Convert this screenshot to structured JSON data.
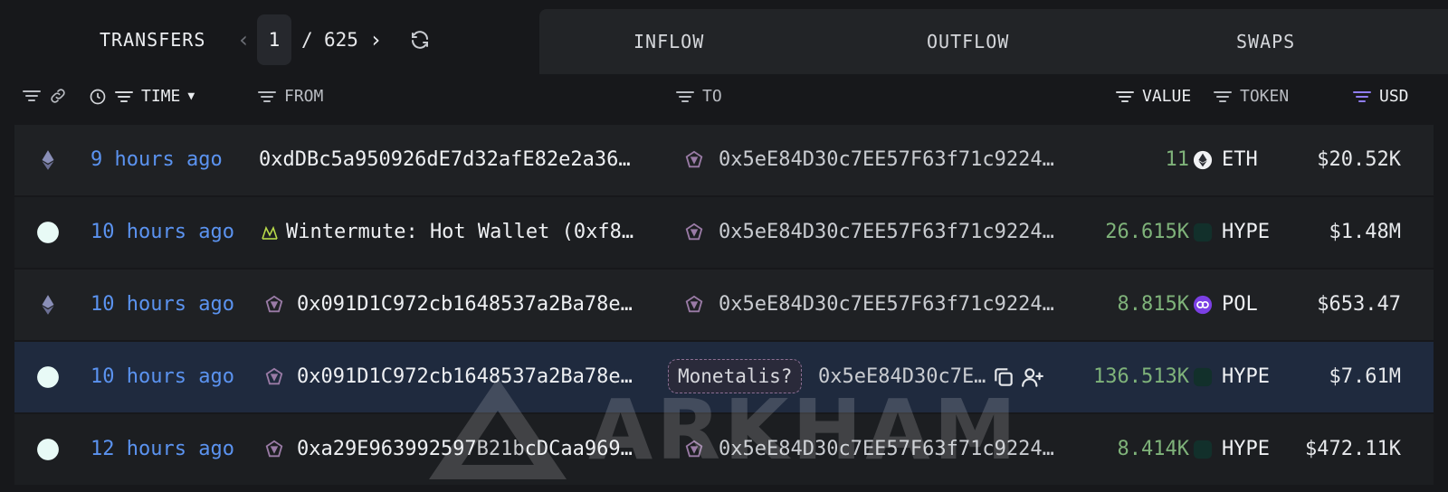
{
  "topbar": {
    "transfers_label": "TRANSFERS",
    "prev_icon": "chevron-left-icon",
    "page_current": "1",
    "page_sep": "/",
    "page_total": "625",
    "next_icon": "chevron-right-icon",
    "refresh_icon": "refresh-icon",
    "tabs": [
      {
        "label": "INFLOW"
      },
      {
        "label": "OUTFLOW"
      },
      {
        "label": "SWAPS"
      }
    ]
  },
  "columns": {
    "time": "TIME",
    "from": "FROM",
    "to": "TO",
    "value": "VALUE",
    "token": "TOKEN",
    "usd": "USD"
  },
  "rows": [
    {
      "chain_icon": "ethereum-icon",
      "time": "9 hours ago",
      "from": "0xdDBc5a950926dE7d32afE82e2a36…",
      "to": "0x5eE84D30c7EE57F63f71c9224…",
      "value": "11",
      "token_icon": "eth-token-icon",
      "token": "ETH",
      "usd": "$20.52K"
    },
    {
      "chain_icon": "hyperliquid-icon",
      "time": "10 hours ago",
      "from": "Wintermute: Hot Wallet (0xf8…",
      "to": "0x5eE84D30c7EE57F63f71c9224…",
      "value": "26.615K",
      "token_icon": "hype-token-icon",
      "token": "HYPE",
      "usd": "$1.48M"
    },
    {
      "chain_icon": "ethereum-icon",
      "time": "10 hours ago",
      "from": "0x091D1C972cb1648537a2Ba78e…",
      "to": "0x5eE84D30c7EE57F63f71c9224…",
      "value": "8.815K",
      "token_icon": "pol-token-icon",
      "token": "POL",
      "usd": "$653.47"
    },
    {
      "chain_icon": "hyperliquid-icon",
      "time": "10 hours ago",
      "from": "0x091D1C972cb1648537a2Ba78e…",
      "to_tag": "Monetalis?",
      "to": "0x5eE84D30c7E…",
      "value": "136.513K",
      "token_icon": "hype-token-icon",
      "token": "HYPE",
      "usd": "$7.61M"
    },
    {
      "chain_icon": "hyperliquid-icon",
      "time": "12 hours ago",
      "from": "0xa29E963992597B21bcDCaa969…",
      "to": "0x5eE84D30c7EE57F63f71c9224…",
      "value": "8.414K",
      "token_icon": "hype-token-icon",
      "token": "HYPE",
      "usd": "$472.11K"
    }
  ],
  "watermark": {
    "text": "ARKHAM"
  },
  "colors": {
    "background": "#17181b",
    "time_link": "#5b93f0",
    "value_green": "#7fb37a",
    "highlight_row": "#1f2a3e",
    "usd_sort_accent": "#8f7df0"
  }
}
